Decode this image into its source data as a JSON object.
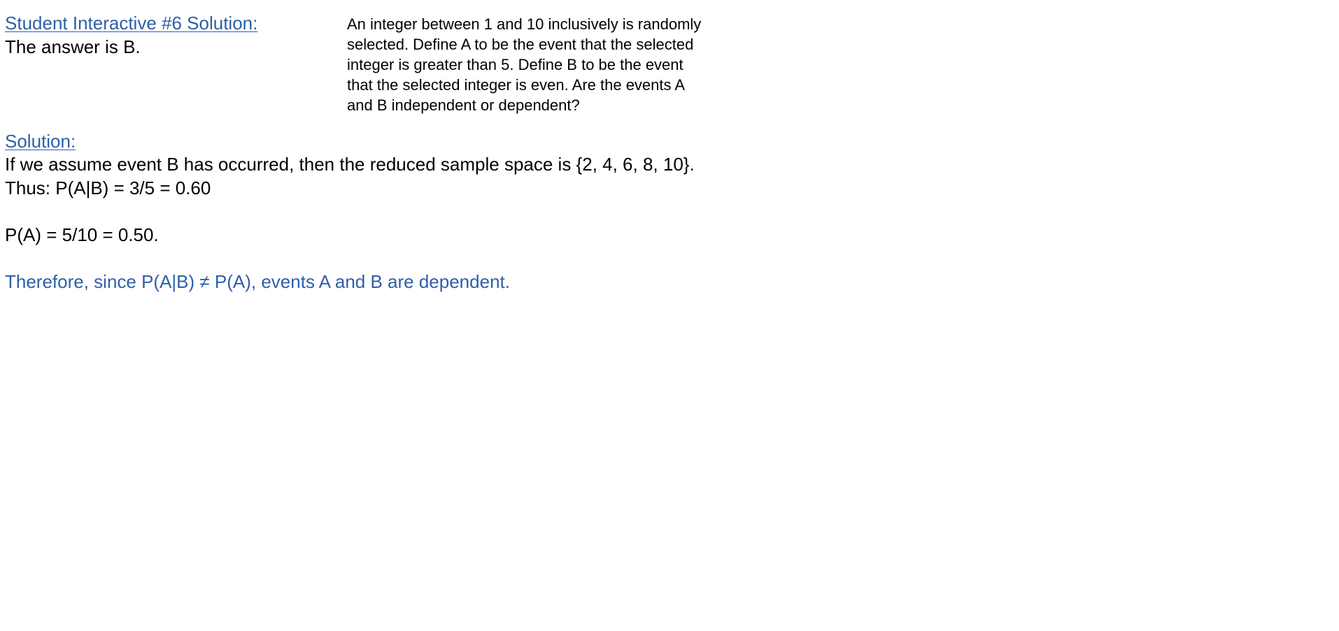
{
  "title": "Student Interactive #6 Solution:",
  "answer": "The answer is B.",
  "question": "An integer between 1 and 10 inclusively is randomly\nselected.  Define A to be the event that the selected\ninteger is greater than 5.  Define B to be the event\nthat the selected integer is even.  Are the events A\nand B independent or dependent?",
  "solution": {
    "heading": "Solution:",
    "line1": "If we assume event B has occurred, then the reduced sample space is {2, 4, 6, 8, 10}.",
    "line2": "Thus:  P(A|B) = 3/5 = 0.60",
    "line3": "P(A) = 5/10 = 0.50.",
    "conclusion": "Therefore, since P(A|B) ≠ P(A), events A and B are dependent."
  },
  "colors": {
    "accent": "#2e5fa8",
    "text": "#000000",
    "background": "#ffffff"
  }
}
